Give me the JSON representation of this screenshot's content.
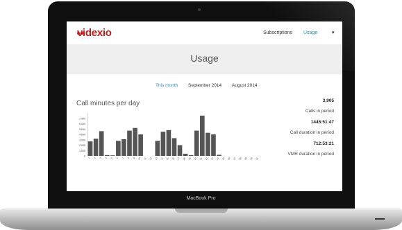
{
  "app": {
    "logo": "videxio",
    "brand_color": "#c41a1a",
    "accent_color": "#2b8cc4"
  },
  "nav": {
    "subscriptions": "Subscriptions",
    "usage": "Usage",
    "caret": "▾"
  },
  "page": {
    "title": "Usage"
  },
  "tabs": {
    "this_month": "This month",
    "september": "September 2014",
    "august": "August 2014"
  },
  "chart_data": {
    "type": "bar",
    "title": "Call minutes per day",
    "ylim": [
      0,
      8000
    ],
    "yticks": [
      "0",
      "1.000",
      "2.000",
      "3.000",
      "4.000",
      "5.000",
      "6.000",
      "7.000"
    ],
    "categories": [
      "1",
      "2",
      "3",
      "4",
      "5",
      "6",
      "7",
      "8",
      "9",
      "10",
      "11",
      "12",
      "13",
      "14",
      "15",
      "16",
      "17",
      "18",
      "19",
      "20",
      "21",
      "22",
      "23",
      "24",
      "25",
      "26",
      "27",
      "28",
      "29",
      "30",
      "31"
    ],
    "values": [
      2700,
      3200,
      4600,
      150,
      100,
      2800,
      3100,
      4700,
      5200,
      4000,
      0,
      0,
      2800,
      4500,
      4800,
      3300,
      2000,
      400,
      150,
      4700,
      7500,
      4300,
      4000,
      200,
      0,
      0,
      0,
      0,
      0,
      0,
      0
    ],
    "bar_color": "#555555"
  },
  "stats": [
    {
      "value": "3,905",
      "label": "Calls in period"
    },
    {
      "value": "1445:51:47",
      "label": "Call duration in period"
    },
    {
      "value": "712:53:21",
      "label": "VMR duration in period"
    }
  ],
  "device": {
    "label": "MacBook Pro"
  }
}
